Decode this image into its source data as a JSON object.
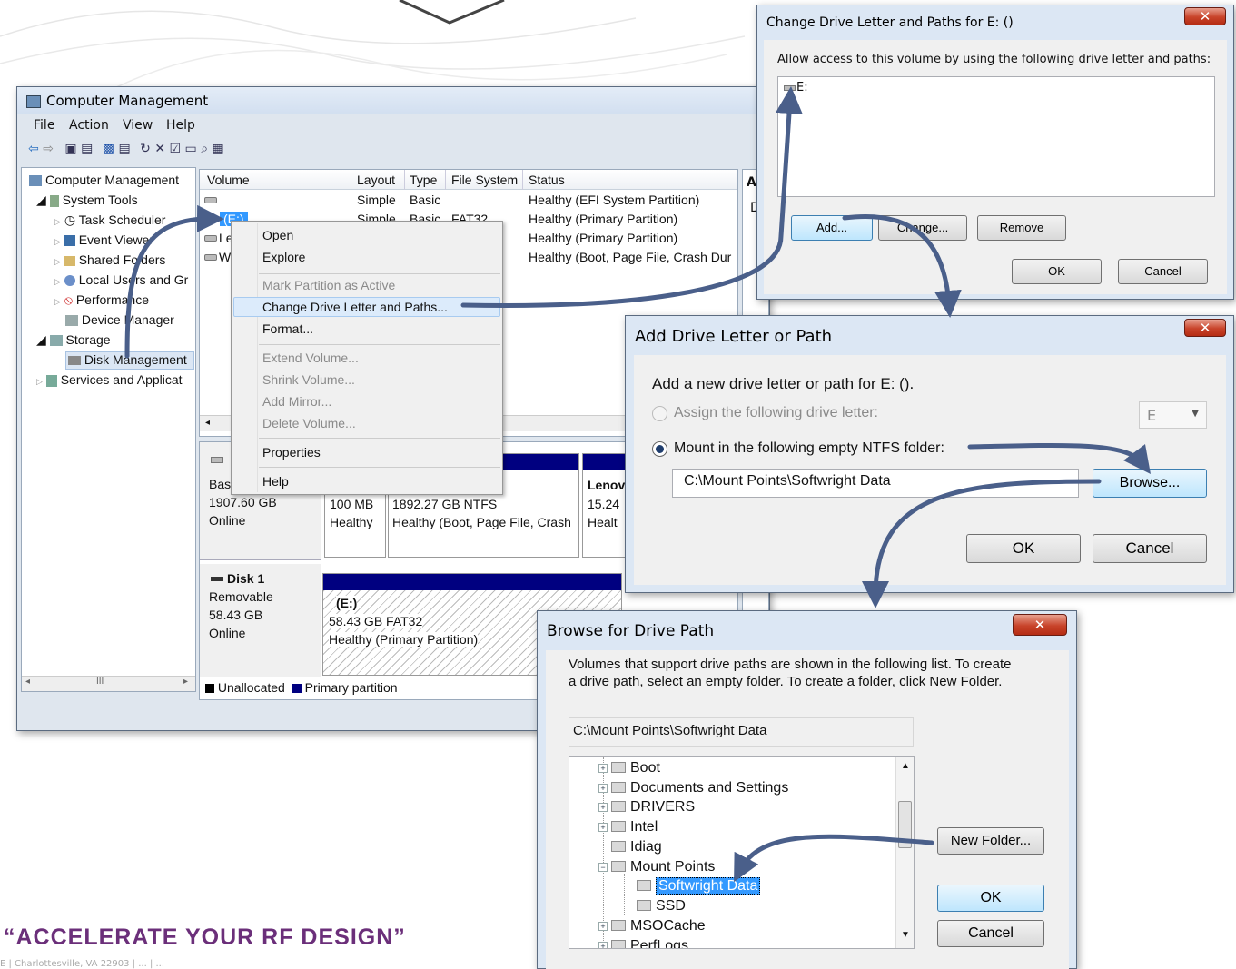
{
  "colors": {
    "accent": "#4a5f8a",
    "tagline": "#6b2f7a",
    "selection": "#3399ff",
    "partition": "#000080"
  },
  "tagline": "“ACCELERATE YOUR RF DESIGN”",
  "footer": "E | Charlottesville, VA 22903  |  ...  |  ...",
  "cm": {
    "title": "Computer Management",
    "menu": [
      "File",
      "Action",
      "View",
      "Help"
    ],
    "tree": [
      {
        "label": "Computer Management",
        "icon": "computer-management-icon"
      },
      {
        "label": "System Tools",
        "icon": "tools-icon"
      },
      {
        "label": "Task Scheduler",
        "icon": "clock-icon"
      },
      {
        "label": "Event Viewer",
        "icon": "event-viewer-icon"
      },
      {
        "label": "Shared Folders",
        "icon": "shared-folder-icon"
      },
      {
        "label": "Local Users and Gr",
        "icon": "users-icon"
      },
      {
        "label": "Performance",
        "icon": "performance-icon"
      },
      {
        "label": "Device Manager",
        "icon": "device-manager-icon"
      },
      {
        "label": "Storage",
        "icon": "storage-icon"
      },
      {
        "label": "Disk Management",
        "icon": "disk-icon"
      },
      {
        "label": "Services and Applicat",
        "icon": "services-icon"
      }
    ],
    "columns": [
      "Volume",
      "Layout",
      "Type",
      "File System",
      "Status",
      "A"
    ],
    "rows": [
      {
        "volume": "",
        "layout": "Simple",
        "type": "Basic",
        "fs": "",
        "status": "Healthy (EFI System Partition)"
      },
      {
        "volume": "(E:)",
        "layout": "Simple",
        "type": "Basic",
        "fs": "FAT32",
        "status": "Healthy (Primary Partition)"
      },
      {
        "volume": "Le",
        "layout": "",
        "type": "",
        "fs": "",
        "status": "Healthy (Primary Partition)"
      },
      {
        "volume": "W",
        "layout": "",
        "type": "",
        "fs": "",
        "status": "Healthy (Boot, Page File, Crash Dur"
      }
    ],
    "disk0": {
      "type": "Bas",
      "size": "1907.60 GB",
      "state": "Online",
      "p1": {
        "size": "100 MB",
        "status": "Healthy"
      },
      "p2": {
        "size": "1892.27 GB NTFS",
        "status": "Healthy (Boot, Page File, Crash"
      },
      "p3": {
        "name": "Lenov",
        "size": "15.24",
        "status": "Healt"
      }
    },
    "disk1": {
      "name": "Disk 1",
      "type": "Removable",
      "size": "58.43 GB",
      "state": "Online",
      "part": {
        "name": "(E:)",
        "size": "58.43 GB FAT32",
        "status": "Healthy (Primary Partition)"
      }
    },
    "legend": [
      "Unallocated",
      "Primary partition"
    ],
    "right_col_letters": [
      "A",
      "D"
    ]
  },
  "context_menu": {
    "items": [
      {
        "label": "Open",
        "disabled": false
      },
      {
        "label": "Explore",
        "disabled": false
      },
      {
        "label": "Mark Partition as Active",
        "disabled": true
      },
      {
        "label": "Change Drive Letter and Paths...",
        "disabled": false
      },
      {
        "label": "Format...",
        "disabled": false
      },
      {
        "label": "Extend Volume...",
        "disabled": true
      },
      {
        "label": "Shrink Volume...",
        "disabled": true
      },
      {
        "label": "Add Mirror...",
        "disabled": true
      },
      {
        "label": "Delete Volume...",
        "disabled": true
      },
      {
        "label": "Properties",
        "disabled": false
      },
      {
        "label": "Help",
        "disabled": false
      }
    ]
  },
  "cdl": {
    "title": "Change Drive Letter and Paths for E: ()",
    "instruction": "Allow access to this volume by using the following drive letter and paths:",
    "list_item": "E:",
    "add": "Add...",
    "change": "Change...",
    "remove": "Remove",
    "ok": "OK",
    "cancel": "Cancel"
  },
  "adl": {
    "title": "Add Drive Letter or Path",
    "prompt": "Add a new drive letter or path for E: ().",
    "opt_assign": "Assign the following drive letter:",
    "drive_value": "E",
    "opt_mount": "Mount in the following empty NTFS folder:",
    "path": "C:\\Mount Points\\Softwright Data",
    "browse": "Browse...",
    "ok": "OK",
    "cancel": "Cancel"
  },
  "bdp": {
    "title": "Browse for Drive Path",
    "description": "Volumes that support drive paths are shown in the following list. To create a drive path, select an empty folder. To create a folder, click New Folder.",
    "path": "C:\\Mount Points\\Softwright Data",
    "tree": [
      {
        "label": "Boot",
        "level": 0,
        "exp": "+"
      },
      {
        "label": "Documents and Settings",
        "level": 0,
        "exp": "+"
      },
      {
        "label": "DRIVERS",
        "level": 0,
        "exp": "+"
      },
      {
        "label": "Intel",
        "level": 0,
        "exp": "+"
      },
      {
        "label": "Idiag",
        "level": 0,
        "exp": ""
      },
      {
        "label": "Mount Points",
        "level": 0,
        "exp": "-"
      },
      {
        "label": "Softwright Data",
        "level": 1,
        "exp": "",
        "selected": true
      },
      {
        "label": "SSD",
        "level": 1,
        "exp": ""
      },
      {
        "label": "MSOCache",
        "level": 0,
        "exp": "+"
      },
      {
        "label": "PerfLogs",
        "level": 0,
        "exp": "+"
      }
    ],
    "new_folder": "New Folder...",
    "ok": "OK",
    "cancel": "Cancel"
  }
}
